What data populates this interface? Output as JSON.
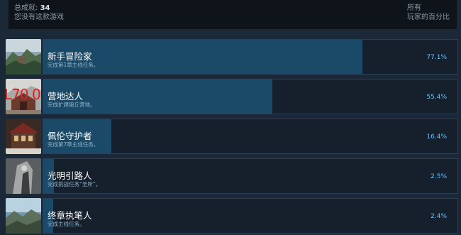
{
  "header": {
    "total_label": "总成就:",
    "total_count": "34",
    "not_owned": "您没有这款游戏",
    "scope": "所有",
    "global_pct_label": "玩家的百分比"
  },
  "overlay_text": "L70.0",
  "achievements": [
    {
      "title": "新手冒险家",
      "desc": "完成第1章主线任务。",
      "percent_label": "77.1%",
      "percent": 77.1
    },
    {
      "title": "营地达人",
      "desc": "完成扩建狼丘营地。",
      "percent_label": "55.4%",
      "percent": 55.4
    },
    {
      "title": "佩伦守护者",
      "desc": "完成第7章主线任务。",
      "percent_label": "16.4%",
      "percent": 16.4
    },
    {
      "title": "光明引路人",
      "desc": "完成挑战任务“圣所”。",
      "percent_label": "2.5%",
      "percent": 2.5
    },
    {
      "title": "终章执笔人",
      "desc": "完成主线任务。",
      "percent_label": "2.4%",
      "percent": 2.4
    }
  ]
}
